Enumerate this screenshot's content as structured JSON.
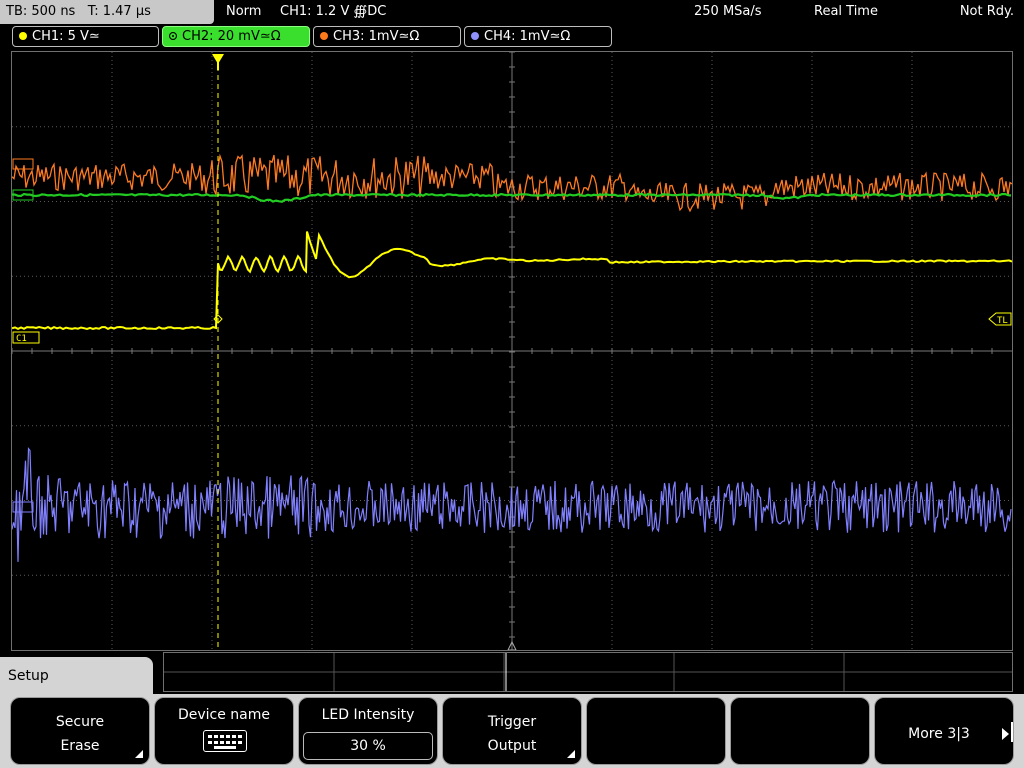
{
  "status": {
    "timebase": "TB: 500 ns   T: 1.47 µs",
    "mode": "Norm",
    "trigger": "CH1: 1.2 V ∰DC",
    "sample_rate": "250 MSa/s",
    "acquisition": "Real Time",
    "state": "Not Rdy."
  },
  "channels": [
    {
      "label": "CH1: 5 V≃",
      "color": "#ffff00"
    },
    {
      "label": "CH2: 20 mV≃Ω",
      "color": "#32d22a"
    },
    {
      "label": "CH3: 1mV≃Ω",
      "color": "#ff7a1a"
    },
    {
      "label": "CH4: 1mV≃Ω",
      "color": "#9090ff"
    }
  ],
  "screen": {
    "trigger_level_marker": "TL",
    "ch1_marker": "C1",
    "colors": {
      "ch1": "#ffff00",
      "ch2": "#22cc22",
      "ch3": "#ff7a20",
      "ch4": "#8080ff",
      "grid": "#5a5a5a"
    }
  },
  "menu": {
    "title": "Setup",
    "softkeys": [
      {
        "line1": "Secure",
        "line2": "Erase"
      },
      {
        "line1": "Device name",
        "icon": "keyboard-icon"
      },
      {
        "line1": "LED Intensity",
        "value": "30 %"
      },
      {
        "line1": "Trigger",
        "line2": "Output"
      },
      {
        "line1": ""
      },
      {
        "line1": ""
      },
      {
        "line1": "More 3|3"
      }
    ]
  }
}
